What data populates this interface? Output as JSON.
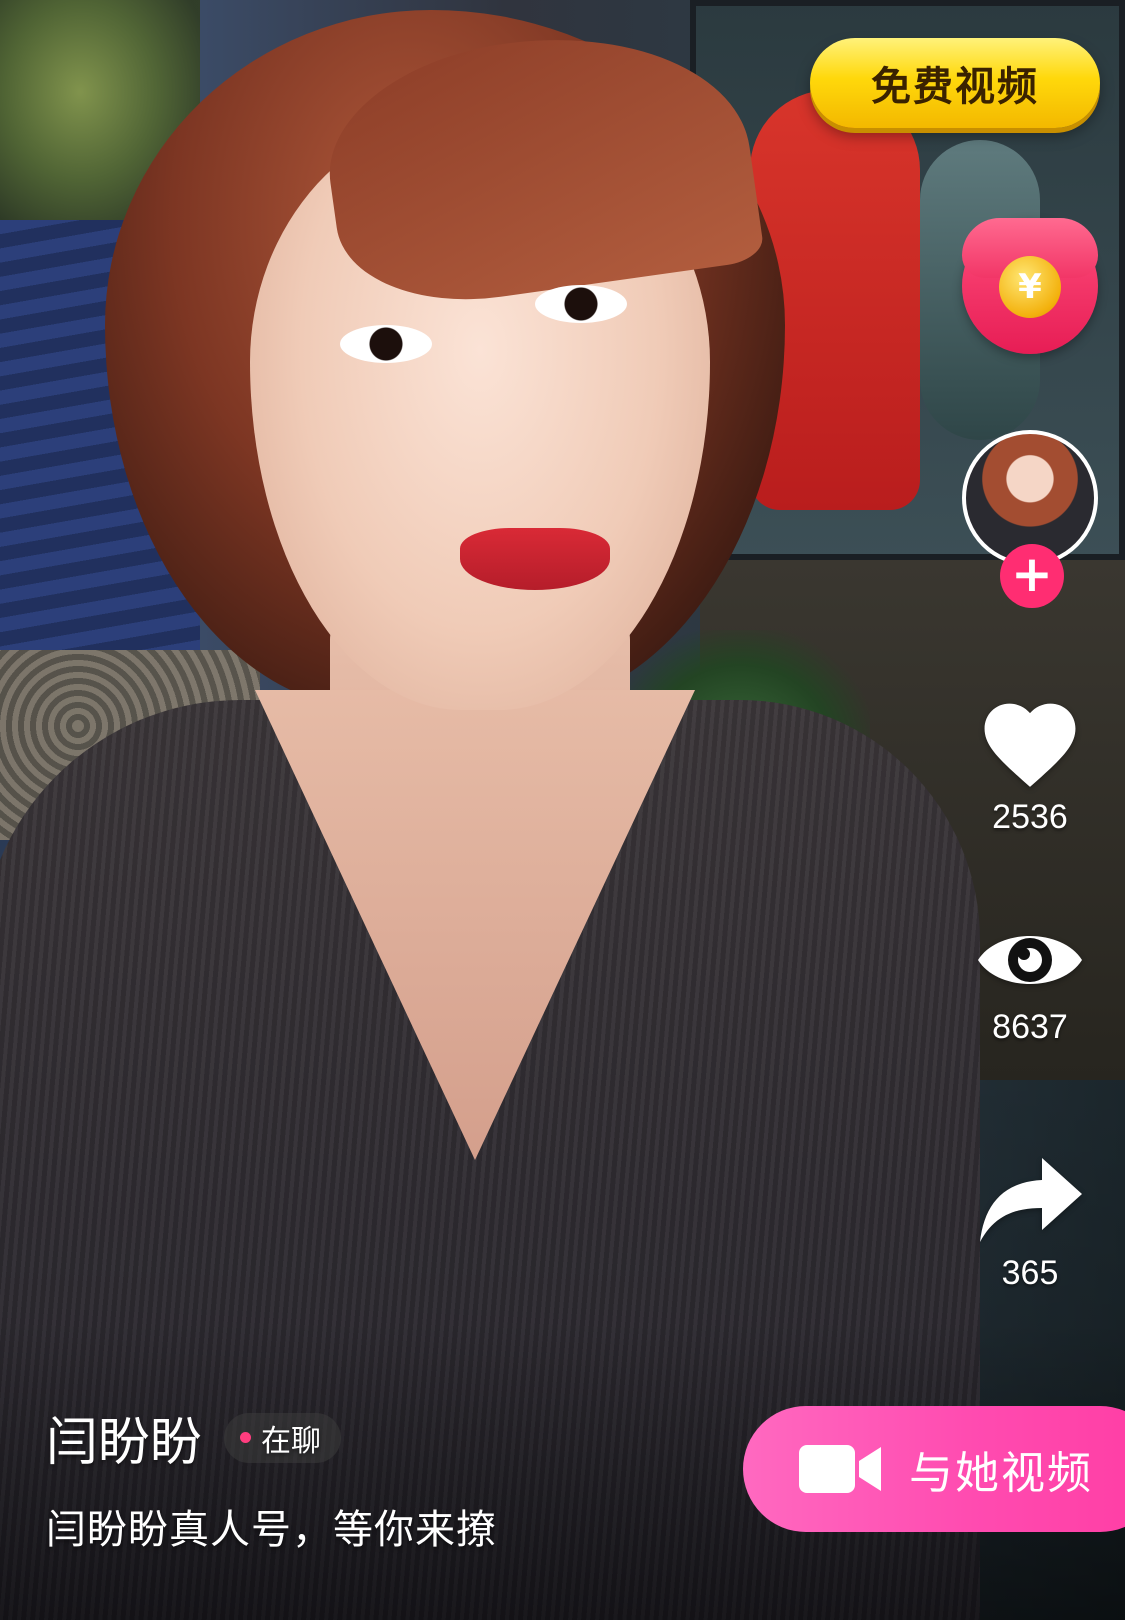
{
  "top_button": {
    "label": "免费视频",
    "bg_color": "#ffd80b"
  },
  "red_packet": {
    "icon": "red-envelope-icon",
    "coin_symbol": "¥"
  },
  "creator": {
    "follow_symbol": "+",
    "name": "闫盼盼",
    "status": "在聊",
    "status_dot_color": "#ff3d7f",
    "description": "闫盼盼真人号，等你来撩"
  },
  "actions": {
    "likes": {
      "icon": "heart-icon",
      "count": "2536"
    },
    "views": {
      "icon": "eye-icon",
      "count": "8637"
    },
    "shares": {
      "icon": "share-icon",
      "count": "365"
    }
  },
  "video_call_button": {
    "label": "与她视频",
    "icon": "video-camera-icon",
    "color": "#ff4bb0"
  }
}
